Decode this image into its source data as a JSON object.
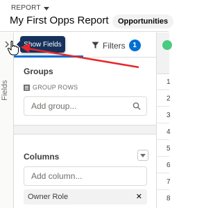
{
  "header": {
    "report_label": "REPORT",
    "report_title": "My First Opps Report",
    "report_type_chip": "Opportunities"
  },
  "sidebar": {
    "collapse_label": "Fields"
  },
  "tooltip": {
    "text": "Show Fields"
  },
  "tabs": {
    "filters_label": "Filters",
    "filters_count": "1"
  },
  "groups": {
    "title": "Groups",
    "group_rows_label": "GROUP ROWS",
    "add_group_placeholder": "Add group..."
  },
  "columns": {
    "title": "Columns",
    "add_column_placeholder": "Add column...",
    "items": [
      {
        "label": "Owner Role"
      }
    ]
  },
  "table": {
    "row_numbers": [
      "1",
      "2",
      "3",
      "4",
      "5",
      "6",
      "7",
      "8"
    ]
  },
  "colors": {
    "accent": "#0070d2",
    "annotation_arrow": "#e8262b",
    "tooltip_bg": "#16325c",
    "success": "#4bca81"
  },
  "icons": {
    "report_caret": "chevron-down-icon",
    "edit": "pencil-icon",
    "expand_sidebar": "chevron-right-icon",
    "filters": "funnel-icon",
    "group_rows": "list-icon",
    "search": "search-icon",
    "remove": "close-icon",
    "cursor": "hand-pointer-icon"
  }
}
